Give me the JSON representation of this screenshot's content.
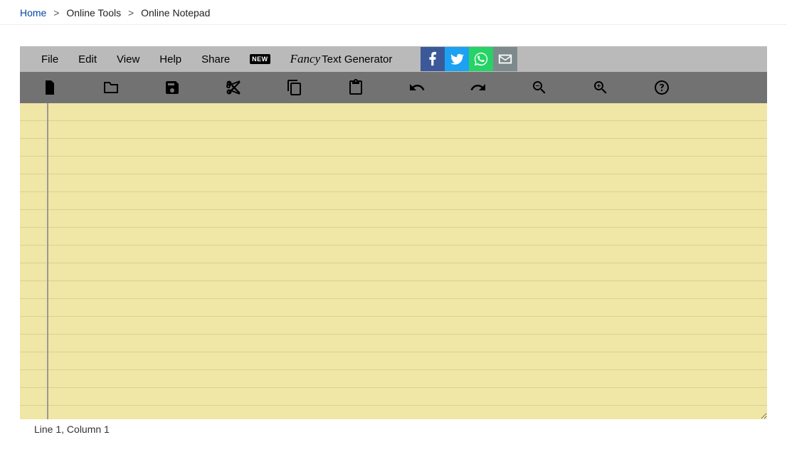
{
  "breadcrumb": {
    "home": "Home",
    "sep": ">",
    "tools": "Online Tools",
    "current": "Online Notepad"
  },
  "menu": {
    "file": "File",
    "edit": "Edit",
    "view": "View",
    "help": "Help",
    "share": "Share",
    "new_badge": "NEW",
    "fancy_word": "Fancy",
    "fancy_rest": " Text Generator"
  },
  "toolbar_icons": {
    "new": "new-file-icon",
    "open": "open-folder-icon",
    "save": "save-icon",
    "cut": "cut-icon",
    "copy": "copy-icon",
    "paste": "paste-icon",
    "undo": "undo-icon",
    "redo": "redo-icon",
    "zoom_out": "zoom-out-icon",
    "zoom_in": "zoom-in-icon",
    "help": "help-icon"
  },
  "social": {
    "facebook": "facebook",
    "twitter": "twitter",
    "whatsapp": "whatsapp",
    "email": "email"
  },
  "editor": {
    "value": "",
    "placeholder": ""
  },
  "status": "Line 1, Column 1"
}
